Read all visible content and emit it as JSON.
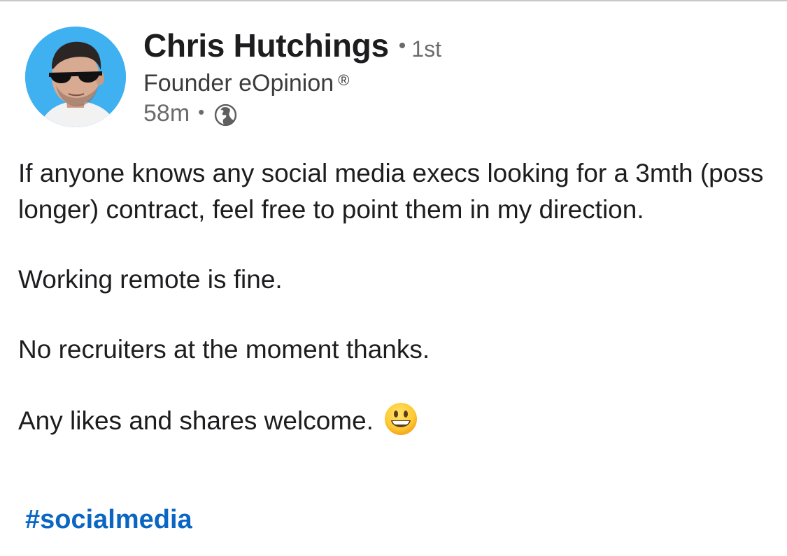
{
  "post": {
    "author": {
      "name": "Chris Hutchings",
      "degree": "1st",
      "headline": "Founder eOpinion",
      "headline_mark": "®",
      "avatar_icon": "profile-photo"
    },
    "meta": {
      "time": "58m",
      "visibility_icon": "globe-icon"
    },
    "body": {
      "paragraph_1": "If anyone knows any social media execs looking for a 3mth (poss longer) contract, feel free to point them in my direction.",
      "paragraph_2": "Working remote is fine.",
      "paragraph_3": "No recruiters at the moment thanks.",
      "paragraph_4": "Any likes and shares welcome.",
      "paragraph_4_emoji": "grinning-face-emoji"
    },
    "hashtag": "#socialmedia"
  },
  "colors": {
    "avatar_background": "#3fb0f0",
    "hashtag": "#0a66c2",
    "secondary_text": "#6b6b6b",
    "primary_text": "#1d1d1f"
  }
}
